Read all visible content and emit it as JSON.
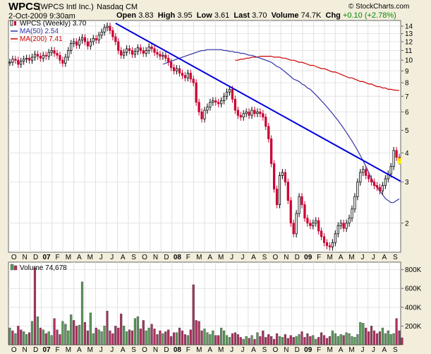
{
  "header": {
    "symbol": "WPCS",
    "company": "(WPCS Intl Inc.)",
    "exchange": "Nasdaq CM",
    "watermark": "© StockCharts.com",
    "date": "2-Oct-2009 9:30am",
    "stats": {
      "open_label": "Open",
      "open": "3.83",
      "high_label": "High",
      "high": "3.95",
      "low_label": "Low",
      "low": "3.61",
      "last_label": "Last",
      "last": "3.70",
      "volume_label": "Volume",
      "volume": "74.7K",
      "chg_label": "Chg",
      "chg": "+0.10 (+2.78%)"
    }
  },
  "colors": {
    "background": "#f3eedc",
    "panel": "#ffffff",
    "up_candle": "#000000",
    "down_candle": "#cc0033",
    "ma50": "#3333aa",
    "ma200": "#cc0000",
    "trendline": "#0000dd",
    "volume_up": "#5c9a5c",
    "volume_down": "#b03060",
    "highlight": "#ffff00"
  },
  "chart_data": [
    {
      "type": "candlestick",
      "legend": {
        "position": "top-left",
        "items": [
          {
            "name": "WPCS (Weekly) 3.70",
            "style": "candle"
          },
          {
            "name": "MA(50) 2.54",
            "color": "#3333aa"
          },
          {
            "name": "MA(200) 7.41",
            "color": "#cc0000"
          }
        ]
      },
      "y_scale": "log",
      "ylim": [
        1.5,
        14.8
      ],
      "y_ticks": [
        14,
        13,
        12,
        11,
        10,
        9,
        8,
        7,
        6,
        5,
        4,
        3,
        2
      ],
      "x_labels": [
        "O",
        "N",
        "D",
        "07",
        "F",
        "M",
        "A",
        "M",
        "J",
        "J",
        "A",
        "S",
        "O",
        "N",
        "D",
        "08",
        "F",
        "M",
        "A",
        "M",
        "J",
        "J",
        "A",
        "S",
        "O",
        "N",
        "D",
        "09",
        "F",
        "M",
        "A",
        "M",
        "J",
        "J",
        "A",
        "S"
      ],
      "grid": true,
      "weekly_close": [
        9.8,
        10.1,
        10.0,
        9.6,
        9.9,
        10.1,
        10.2,
        10.0,
        10.3,
        10.6,
        10.4,
        10.2,
        10.5,
        10.4,
        10.8,
        11.0,
        10.7,
        10.5,
        10.0,
        9.7,
        10.3,
        11.0,
        11.8,
        12.0,
        11.6,
        12.2,
        12.5,
        12.0,
        11.5,
        12.0,
        12.4,
        12.2,
        12.8,
        13.2,
        13.8,
        14.0,
        13.4,
        12.6,
        12.0,
        11.0,
        10.5,
        10.8,
        11.2,
        11.0,
        10.6,
        10.9,
        11.3,
        11.0,
        10.7,
        11.0,
        11.4,
        11.2,
        10.8,
        10.6,
        10.4,
        10.5,
        10.2,
        9.8,
        9.3,
        9.0,
        9.2,
        8.8,
        8.6,
        8.4,
        8.8,
        8.3,
        8.0,
        6.6,
        6.0,
        5.6,
        6.1,
        6.3,
        6.6,
        6.7,
        6.6,
        6.5,
        6.7,
        7.0,
        7.3,
        7.5,
        6.8,
        6.1,
        5.8,
        5.7,
        5.9,
        6.0,
        5.8,
        6.1,
        5.9,
        6.0,
        5.9,
        5.7,
        5.2,
        4.6,
        3.6,
        2.8,
        2.4,
        3.2,
        3.3,
        3.0,
        2.5,
        2.0,
        1.8,
        2.2,
        2.6,
        2.4,
        2.1,
        2.0,
        1.95,
        2.0,
        2.05,
        1.85,
        1.75,
        1.65,
        1.6,
        1.58,
        1.65,
        1.8,
        1.95,
        2.0,
        1.9,
        2.0,
        2.1,
        2.3,
        2.6,
        3.0,
        3.3,
        3.4,
        3.2,
        3.1,
        3.0,
        2.9,
        2.85,
        2.75,
        2.9,
        3.1,
        3.25,
        3.5,
        4.1,
        3.83,
        3.7
      ],
      "ma50": {
        "name": "MA(50)",
        "last": 2.54,
        "values": [
          null,
          null,
          null,
          null,
          null,
          null,
          null,
          null,
          null,
          null,
          9.6,
          9.7,
          9.8,
          9.9,
          10.0,
          10.1,
          10.2,
          10.3,
          10.4,
          10.5,
          10.6,
          10.7,
          10.8,
          10.9,
          11.0,
          11.0,
          11.1,
          11.1,
          11.1,
          11.1,
          11.1,
          11.1,
          11.0,
          11.0,
          10.9,
          10.9,
          10.8,
          10.8,
          10.7,
          10.7,
          10.6,
          10.5,
          10.5,
          10.4,
          10.3,
          10.2,
          10.1,
          10.0,
          9.9,
          9.8,
          9.6,
          9.4,
          9.3,
          9.1,
          8.9,
          8.7,
          8.5,
          8.3,
          8.2,
          8.1,
          7.9,
          7.8,
          7.6,
          7.5,
          7.3,
          7.1,
          6.9,
          6.7,
          6.5,
          6.3,
          6.1,
          5.9,
          5.7,
          5.5,
          5.3,
          5.1,
          4.9,
          4.7,
          4.5,
          4.3,
          4.1,
          3.9,
          3.7,
          3.5,
          3.3,
          3.1,
          2.95,
          2.85,
          2.75,
          2.65,
          2.55,
          2.5,
          2.45,
          2.45,
          2.5,
          2.54
        ]
      },
      "ma200": {
        "name": "MA(200)",
        "last": 7.41,
        "values": [
          10.0,
          10.0,
          10.1,
          10.1,
          10.2,
          10.2,
          10.3,
          10.3,
          10.3,
          10.4,
          10.4,
          10.4,
          10.4,
          10.4,
          10.3,
          10.3,
          10.3,
          10.2,
          10.2,
          10.1,
          10.0,
          10.0,
          9.9,
          9.8,
          9.8,
          9.7,
          9.6,
          9.5,
          9.5,
          9.4,
          9.3,
          9.2,
          9.2,
          9.1,
          9.0,
          8.9,
          8.9,
          8.8,
          8.7,
          8.6,
          8.5,
          8.4,
          8.4,
          8.3,
          8.2,
          8.1,
          8.1,
          8.0,
          7.9,
          7.9,
          7.8,
          7.7,
          7.7,
          7.6,
          7.6,
          7.5,
          7.5,
          7.45,
          7.43,
          7.41
        ]
      },
      "trendline": {
        "from": {
          "week": 38,
          "price": 14.4
        },
        "to": {
          "week": 141,
          "price": 3.0
        }
      }
    },
    {
      "type": "bar",
      "legend": {
        "position": "top-left",
        "items": [
          {
            "name": "Volume 74,678"
          }
        ]
      },
      "ylim": [
        0,
        880000
      ],
      "y_ticks": [
        {
          "value": 800000,
          "label": "800K"
        },
        {
          "value": 600000,
          "label": "600K"
        },
        {
          "value": 400000,
          "label": "400K"
        },
        {
          "value": 200000,
          "label": "200K"
        }
      ],
      "x_labels": [
        "O",
        "N",
        "D",
        "07",
        "F",
        "M",
        "A",
        "M",
        "J",
        "J",
        "A",
        "S",
        "O",
        "N",
        "D",
        "08",
        "F",
        "M",
        "A",
        "M",
        "J",
        "J",
        "A",
        "S",
        "O",
        "N",
        "D",
        "09",
        "F",
        "M",
        "A",
        "M",
        "J",
        "J",
        "A",
        "S"
      ],
      "volumes": [
        180000,
        150000,
        120000,
        200000,
        160000,
        140000,
        110000,
        130000,
        250000,
        820000,
        300000,
        180000,
        160000,
        120000,
        140000,
        100000,
        280000,
        160000,
        110000,
        250000,
        220000,
        150000,
        320000,
        260000,
        200000,
        210000,
        670000,
        240000,
        150000,
        340000,
        120000,
        180000,
        160000,
        140000,
        200000,
        360000,
        150000,
        120000,
        200000,
        180000,
        330000,
        200000,
        140000,
        160000,
        150000,
        280000,
        300000,
        170000,
        260000,
        150000,
        180000,
        220000,
        170000,
        110000,
        150000,
        120000,
        140000,
        160000,
        90000,
        130000,
        130000,
        180000,
        150000,
        110000,
        100000,
        160000,
        640000,
        260000,
        250000,
        150000,
        170000,
        130000,
        110000,
        150000,
        100000,
        100000,
        180000,
        150000,
        100000,
        80000,
        120000,
        130000,
        110000,
        80000,
        60000,
        90000,
        70000,
        100000,
        60000,
        130000,
        90000,
        150000,
        80000,
        110000,
        90000,
        60000,
        120000,
        90000,
        80000,
        110000,
        70000,
        100000,
        80000,
        90000,
        110000,
        140000,
        80000,
        120000,
        90000,
        100000,
        60000,
        80000,
        130000,
        100000,
        70000,
        90000,
        150000,
        120000,
        90000,
        110000,
        100000,
        130000,
        120000,
        90000,
        80000,
        110000,
        240000,
        230000,
        180000,
        140000,
        200000,
        150000,
        120000,
        140000,
        180000,
        120000,
        150000,
        110000,
        120000,
        280000,
        150000,
        75000
      ],
      "up": [
        true,
        false,
        true,
        false,
        false,
        true,
        true,
        false,
        true,
        false,
        true,
        false,
        true,
        false,
        true,
        true,
        false,
        false,
        false,
        true,
        true,
        true,
        true,
        false,
        false,
        true,
        true,
        false,
        false,
        true,
        true,
        false,
        true,
        true,
        true,
        false,
        false,
        false,
        false,
        false,
        false,
        true,
        true,
        false,
        false,
        true,
        true,
        false,
        false,
        true,
        true,
        false,
        false,
        false,
        false,
        true,
        false,
        false,
        false,
        false,
        true,
        false,
        false,
        false,
        true,
        false,
        false,
        false,
        false,
        false,
        true,
        true,
        true,
        true,
        false,
        false,
        true,
        true,
        true,
        true,
        false,
        false,
        false,
        false,
        true,
        true,
        false,
        true,
        false,
        true,
        false,
        false,
        false,
        false,
        false,
        false,
        false,
        true,
        true,
        false,
        false,
        false,
        false,
        true,
        true,
        false,
        false,
        false,
        false,
        true,
        true,
        false,
        false,
        false,
        false,
        false,
        true,
        true,
        true,
        true,
        false,
        true,
        true,
        true,
        true,
        true,
        true,
        true,
        false,
        false,
        false,
        false,
        false,
        false,
        true,
        true,
        true,
        true,
        true,
        false,
        false
      ]
    }
  ]
}
